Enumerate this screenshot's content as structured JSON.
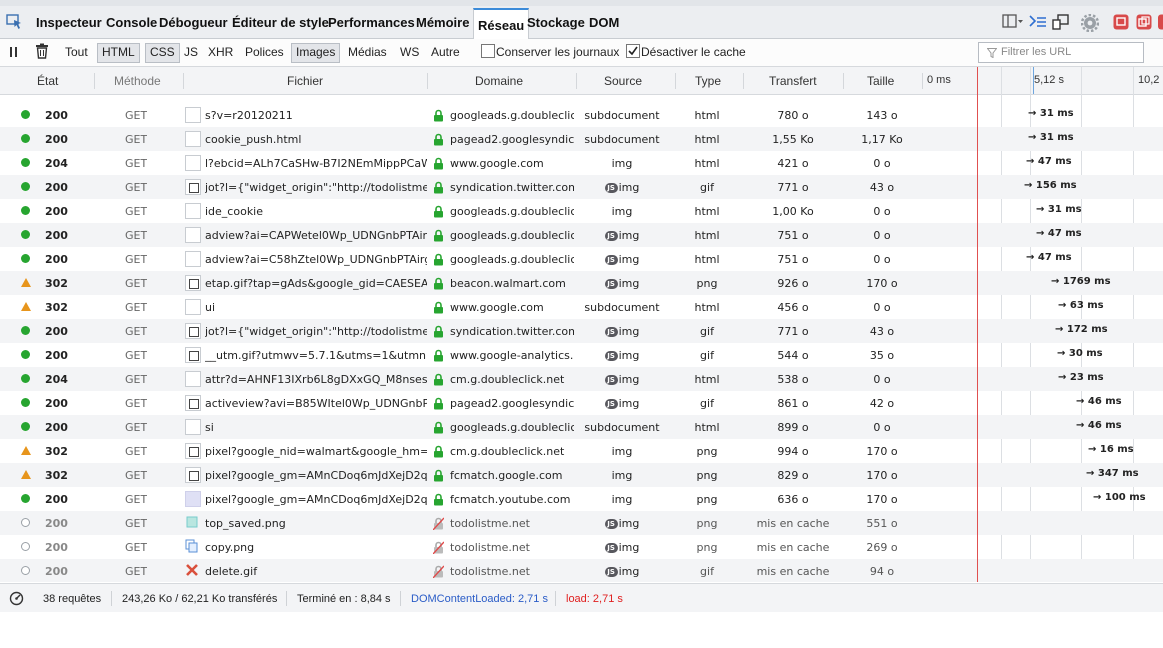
{
  "toolbar": {
    "tabs": [
      "Inspecteur",
      "Console",
      "Débogueur",
      "Éditeur de style",
      "Performances",
      "Mémoire",
      "Réseau",
      "Stockage",
      "DOM"
    ],
    "active_tab": "Réseau"
  },
  "filters": {
    "types": [
      "Tout",
      "HTML",
      "CSS",
      "JS",
      "XHR",
      "Polices",
      "Images",
      "Médias",
      "WS",
      "Autre"
    ],
    "selected": [
      "HTML",
      "CSS",
      "Images"
    ],
    "persist_logs_label": "Conserver les journaux",
    "persist_logs_checked": false,
    "disable_cache_label": "Désactiver le cache",
    "disable_cache_checked": true,
    "url_filter_placeholder": "Filtrer les URL"
  },
  "columns": {
    "status": "État",
    "method": "Méthode",
    "file": "Fichier",
    "domain": "Domaine",
    "cause": "Source",
    "type": "Type",
    "transferred": "Transfert",
    "size": "Taille",
    "timeline_ticks": [
      "0 ms",
      "5,12 s",
      "10,2"
    ]
  },
  "requests": [
    {
      "status": "200",
      "kind": "ok",
      "method": "GET",
      "file": "s?v=r20120211",
      "domain": "googleads.g.doubleclic...",
      "secure": true,
      "cause": "subdocument",
      "js": false,
      "type": "html",
      "transferred": "780 o",
      "size": "143 o",
      "timing": "→ 31 ms"
    },
    {
      "status": "200",
      "kind": "ok",
      "method": "GET",
      "file": "cookie_push.html",
      "domain": "pagead2.googlesyndic...",
      "secure": true,
      "cause": "subdocument",
      "js": false,
      "type": "html",
      "transferred": "1,55 Ko",
      "size": "1,17 Ko",
      "timing": "→ 31 ms"
    },
    {
      "status": "204",
      "kind": "ok",
      "method": "GET",
      "file": "l?ebcid=ALh7CaSHw-B7I2NEmMippPCaW77...",
      "domain": "www.google.com",
      "secure": true,
      "cause": "img",
      "js": false,
      "type": "html",
      "transferred": "421 o",
      "size": "0 o",
      "timing": "→ 47 ms"
    },
    {
      "status": "200",
      "kind": "ok",
      "method": "GET",
      "file": "jot?l={\"widget_origin\":\"http://todolistme.ne...",
      "domain": "syndication.twitter.com",
      "secure": true,
      "cause": "img",
      "js": true,
      "type": "gif",
      "transferred": "771 o",
      "size": "43 o",
      "timing": "→ 156 ms"
    },
    {
      "status": "200",
      "kind": "ok",
      "method": "GET",
      "file": "ide_cookie",
      "domain": "googleads.g.doubleclic...",
      "secure": true,
      "cause": "img",
      "js": false,
      "type": "html",
      "transferred": "1,00 Ko",
      "size": "0 o",
      "timing": "→ 31 ms"
    },
    {
      "status": "200",
      "kind": "ok",
      "method": "GET",
      "file": "adview?ai=CAPWetel0Wp_UDNGnbPTAirgF...",
      "domain": "googleads.g.doubleclic...",
      "secure": true,
      "cause": "img",
      "js": true,
      "type": "html",
      "transferred": "751 o",
      "size": "0 o",
      "timing": "→ 47 ms"
    },
    {
      "status": "200",
      "kind": "ok",
      "method": "GET",
      "file": "adview?ai=C58hZtel0Wp_UDNGnbPTAirgF4...",
      "domain": "googleads.g.doubleclic...",
      "secure": true,
      "cause": "img",
      "js": true,
      "type": "html",
      "transferred": "751 o",
      "size": "0 o",
      "timing": "→ 47 ms"
    },
    {
      "status": "302",
      "kind": "redirect",
      "method": "GET",
      "file": "etap.gif?tap=gAds&google_gid=CAESEAqR...",
      "domain": "beacon.walmart.com",
      "secure": true,
      "cause": "img",
      "js": true,
      "type": "png",
      "transferred": "926 o",
      "size": "170 o",
      "timing": "→ 1769 ms"
    },
    {
      "status": "302",
      "kind": "redirect",
      "method": "GET",
      "file": "ui",
      "domain": "www.google.com",
      "secure": true,
      "cause": "subdocument",
      "js": false,
      "type": "html",
      "transferred": "456 o",
      "size": "0 o",
      "timing": "→ 63 ms"
    },
    {
      "status": "200",
      "kind": "ok",
      "method": "GET",
      "file": "jot?l={\"widget_origin\":\"http://todolistme.ne...",
      "domain": "syndication.twitter.com",
      "secure": true,
      "cause": "img",
      "js": true,
      "type": "gif",
      "transferred": "771 o",
      "size": "43 o",
      "timing": "→ 172 ms"
    },
    {
      "status": "200",
      "kind": "ok",
      "method": "GET",
      "file": "__utm.gif?utmwv=5.7.1&utms=1&utmn=8...",
      "domain": "www.google-analytics....",
      "secure": true,
      "cause": "img",
      "js": true,
      "type": "gif",
      "transferred": "544 o",
      "size": "35 o",
      "timing": "→ 30 ms"
    },
    {
      "status": "204",
      "kind": "ok",
      "method": "GET",
      "file": "attr?d=AHNF13IXrb6L8gDXxGQ_M8nseshlN...",
      "domain": "cm.g.doubleclick.net",
      "secure": true,
      "cause": "img",
      "js": true,
      "type": "html",
      "transferred": "538 o",
      "size": "0 o",
      "timing": "→ 23 ms"
    },
    {
      "status": "200",
      "kind": "ok",
      "method": "GET",
      "file": "activeview?avi=B85WItel0Wp_UDNGnbPTAi...",
      "domain": "pagead2.googlesyndic...",
      "secure": true,
      "cause": "img",
      "js": true,
      "type": "gif",
      "transferred": "861 o",
      "size": "42 o",
      "timing": "→ 46 ms"
    },
    {
      "status": "200",
      "kind": "ok",
      "method": "GET",
      "file": "si",
      "domain": "googleads.g.doubleclic...",
      "secure": true,
      "cause": "subdocument",
      "js": false,
      "type": "html",
      "transferred": "899 o",
      "size": "0 o",
      "timing": "→ 46 ms"
    },
    {
      "status": "302",
      "kind": "redirect",
      "method": "GET",
      "file": "pixel?google_nid=walmart&google_hm=eids...",
      "domain": "cm.g.doubleclick.net",
      "secure": true,
      "cause": "img",
      "js": false,
      "type": "png",
      "transferred": "994 o",
      "size": "170 o",
      "timing": "→ 16 ms"
    },
    {
      "status": "302",
      "kind": "redirect",
      "method": "GET",
      "file": "pixel?google_gm=AMnCDoq6mJdXejD2qMX...",
      "domain": "fcmatch.google.com",
      "secure": true,
      "cause": "img",
      "js": false,
      "type": "png",
      "transferred": "829 o",
      "size": "170 o",
      "timing": "→ 347 ms"
    },
    {
      "status": "200",
      "kind": "ok",
      "method": "GET",
      "file": "pixel?google_gm=AMnCDoq6mJdXejD2qMX...",
      "domain": "fcmatch.youtube.com",
      "secure": true,
      "cause": "img",
      "js": false,
      "type": "png",
      "transferred": "636 o",
      "size": "170 o",
      "timing": "→ 100 ms"
    },
    {
      "status": "200",
      "kind": "cached",
      "method": "GET",
      "file": "top_saved.png",
      "domain": "todolistme.net",
      "secure": false,
      "cause": "img",
      "js": true,
      "type": "png",
      "transferred": "mis en cache",
      "size": "551 o",
      "timing": ""
    },
    {
      "status": "200",
      "kind": "cached",
      "method": "GET",
      "file": "copy.png",
      "domain": "todolistme.net",
      "secure": false,
      "cause": "img",
      "js": true,
      "type": "png",
      "transferred": "mis en cache",
      "size": "269 o",
      "timing": ""
    },
    {
      "status": "200",
      "kind": "cached",
      "method": "GET",
      "file": "delete.gif",
      "domain": "todolistme.net",
      "secure": false,
      "cause": "img",
      "js": true,
      "type": "gif",
      "transferred": "mis en cache",
      "size": "94 o",
      "timing": ""
    }
  ],
  "summary": {
    "requests": "38 requêtes",
    "transferred": "243,26 Ko / 62,21 Ko transférés",
    "finished": "Terminé en : 8,84 s",
    "dom_content_loaded": "DOMContentLoaded: 2,71 s",
    "load": "load: 2,71 s"
  },
  "colors": {
    "ok": "#27a530",
    "redirect": "#e7951c",
    "dcl": "#2a5cc7",
    "load": "#e02020",
    "accent": "#3c8bd9"
  }
}
